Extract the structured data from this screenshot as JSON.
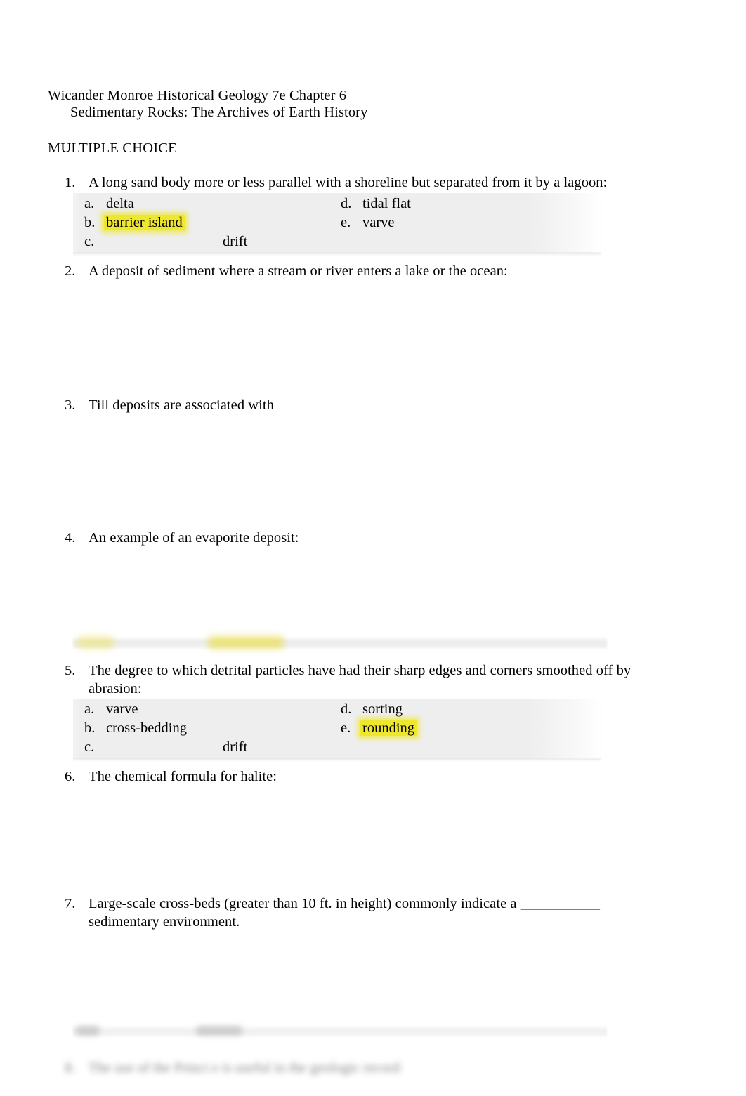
{
  "document": {
    "header": {
      "line1": "Wicander Monroe Historical Geology 7e Chapter 6",
      "line2": "Sedimentary Rocks: The Archives of Earth History"
    },
    "section_label": "MULTIPLE CHOICE",
    "highlight_color": "#efe72e",
    "answer_block_color": "#ececec"
  },
  "questions": [
    {
      "number": "1.",
      "stem": "A long sand body more or less parallel with a shoreline but separated from it by a lagoon:",
      "answers_visible": true,
      "choices": [
        {
          "letter": "a.",
          "text": "delta",
          "highlighted": false,
          "column": 1,
          "row": 1,
          "wide_gap": false
        },
        {
          "letter": "d.",
          "text": "tidal flat",
          "highlighted": false,
          "column": 2,
          "row": 1,
          "wide_gap": false
        },
        {
          "letter": "b.",
          "text": "barrier island",
          "highlighted": true,
          "column": 1,
          "row": 2,
          "wide_gap": false
        },
        {
          "letter": "e.",
          "text": "varve",
          "highlighted": false,
          "column": 2,
          "row": 2,
          "wide_gap": false
        },
        {
          "letter": "c.",
          "text": "drift",
          "highlighted": false,
          "column": 1,
          "row": 3,
          "wide_gap": true
        }
      ]
    },
    {
      "number": "2.",
      "stem": "A deposit of sediment where a stream or river enters a lake or the ocean:",
      "answers_visible": false,
      "choices": []
    },
    {
      "number": "3.",
      "stem": "Till deposits are associated with",
      "answers_visible": false,
      "choices": []
    },
    {
      "number": "4.",
      "stem": "An example of an evaporite deposit:",
      "answers_visible": false,
      "choices": []
    },
    {
      "number": "5.",
      "stem": "The degree to which detrital particles have had their sharp edges and corners smoothed off by abrasion:",
      "answers_visible": true,
      "choices": [
        {
          "letter": "a.",
          "text": "varve",
          "highlighted": false,
          "column": 1,
          "row": 1,
          "wide_gap": false
        },
        {
          "letter": "d.",
          "text": "sorting",
          "highlighted": false,
          "column": 2,
          "row": 1,
          "wide_gap": false
        },
        {
          "letter": "b.",
          "text": "cross-bedding",
          "highlighted": false,
          "column": 1,
          "row": 2,
          "wide_gap": false
        },
        {
          "letter": "e.",
          "text": "rounding",
          "highlighted": true,
          "column": 2,
          "row": 2,
          "wide_gap": false
        },
        {
          "letter": "c.",
          "text": "drift",
          "highlighted": false,
          "column": 1,
          "row": 3,
          "wide_gap": true
        }
      ]
    },
    {
      "number": "6.",
      "stem": "The chemical formula for halite:",
      "answers_visible": false,
      "choices": []
    },
    {
      "number": "7.",
      "stem": "Large-scale cross-beds (greater than 10 ft. in height) commonly indicate a ___________ sedimentary environment.",
      "answers_visible": false,
      "choices": []
    }
  ],
  "trailing_blurred_line": {
    "number": "8.",
    "text": "The use of the Princi e  is useful in the geologic record"
  }
}
